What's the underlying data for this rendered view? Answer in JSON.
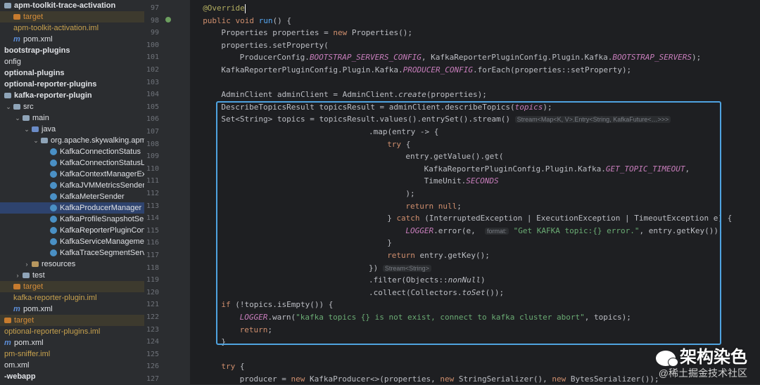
{
  "tree": [
    {
      "label": "apm-toolkit-trace-activation",
      "indent": 0,
      "style": "bold",
      "icon": "folder"
    },
    {
      "label": "target",
      "indent": 1,
      "style": "orange",
      "icon": "folder-target",
      "row": "hlrow"
    },
    {
      "label": "apm-toolkit-activation.iml",
      "indent": 1,
      "style": "yellowish",
      "icon": "none"
    },
    {
      "label": "pom.xml",
      "indent": 1,
      "style": "",
      "icon": "maven"
    },
    {
      "label": "bootstrap-plugins",
      "indent": 0,
      "style": "bold",
      "icon": "none"
    },
    {
      "label": "onfig",
      "indent": 0,
      "style": "",
      "icon": "none"
    },
    {
      "label": "optional-plugins",
      "indent": 0,
      "style": "bold",
      "icon": "none"
    },
    {
      "label": "optional-reporter-plugins",
      "indent": 0,
      "style": "bold",
      "icon": "none"
    },
    {
      "label": "kafka-reporter-plugin",
      "indent": 0,
      "style": "bold",
      "icon": "folder"
    },
    {
      "label": "src",
      "indent": 1,
      "style": "",
      "icon": "folder",
      "arrow": "v"
    },
    {
      "label": "main",
      "indent": 2,
      "style": "",
      "icon": "folder",
      "arrow": "v"
    },
    {
      "label": "java",
      "indent": 3,
      "style": "",
      "icon": "folder-src",
      "arrow": "v"
    },
    {
      "label": "org.apache.skywalking.apm",
      "indent": 4,
      "style": "",
      "icon": "folder",
      "arrow": "v"
    },
    {
      "label": "KafkaConnectionStatus",
      "indent": 5,
      "style": "",
      "icon": "class"
    },
    {
      "label": "KafkaConnectionStatusL",
      "indent": 5,
      "style": "",
      "icon": "class"
    },
    {
      "label": "KafkaContextManagerEx",
      "indent": 5,
      "style": "",
      "icon": "class"
    },
    {
      "label": "KafkaJVMMetricsSender",
      "indent": 5,
      "style": "",
      "icon": "class"
    },
    {
      "label": "KafkaMeterSender",
      "indent": 5,
      "style": "",
      "icon": "class"
    },
    {
      "label": "KafkaProducerManager",
      "indent": 5,
      "style": "",
      "icon": "class",
      "row": "sel"
    },
    {
      "label": "KafkaProfileSnapshotSer",
      "indent": 5,
      "style": "",
      "icon": "class"
    },
    {
      "label": "KafkaReporterPluginCon",
      "indent": 5,
      "style": "",
      "icon": "class"
    },
    {
      "label": "KafkaServiceManagemer",
      "indent": 5,
      "style": "",
      "icon": "class"
    },
    {
      "label": "KafkaTraceSegmentServiceClient",
      "indent": 5,
      "style": "",
      "icon": "class"
    },
    {
      "label": "resources",
      "indent": 3,
      "style": "",
      "icon": "folder-res",
      "arrow": ">"
    },
    {
      "label": "test",
      "indent": 2,
      "style": "",
      "icon": "folder",
      "arrow": ">"
    },
    {
      "label": "target",
      "indent": 1,
      "style": "orange",
      "icon": "folder-target",
      "row": "hlrow"
    },
    {
      "label": "kafka-reporter-plugin.iml",
      "indent": 1,
      "style": "yellowish",
      "icon": "none"
    },
    {
      "label": "pom.xml",
      "indent": 1,
      "style": "",
      "icon": "maven"
    },
    {
      "label": "target",
      "indent": 0,
      "style": "orange",
      "icon": "folder-target",
      "row": "hlrow"
    },
    {
      "label": "optional-reporter-plugins.iml",
      "indent": 0,
      "style": "yellowish",
      "icon": "none"
    },
    {
      "label": "pom.xml",
      "indent": 0,
      "style": "",
      "icon": "maven"
    },
    {
      "label": "pm-sniffer.iml",
      "indent": 0,
      "style": "yellowish",
      "icon": "none"
    },
    {
      "label": "om.xml",
      "indent": 0,
      "style": "",
      "icon": "none"
    },
    {
      "label": "-webapp",
      "indent": 0,
      "style": "bold",
      "icon": "none"
    }
  ],
  "line_numbers": [
    "97",
    "98",
    "99",
    "100",
    "101",
    "102",
    "103",
    "104",
    "105",
    "106",
    "107",
    "108",
    "109",
    "110",
    "111",
    "112",
    "113",
    "114",
    "115",
    "116",
    "117",
    "118",
    "119",
    "120",
    "121",
    "122",
    "123",
    "124",
    "125",
    "126",
    "127"
  ],
  "code_lines": [
    {
      "indent": 1,
      "tokens": [
        [
          "an",
          "@Override"
        ],
        [
          "cursor",
          ""
        ]
      ]
    },
    {
      "indent": 1,
      "tokens": [
        [
          "kw",
          "public "
        ],
        [
          "kw",
          "void "
        ],
        [
          "fn",
          "run"
        ],
        [
          "",
          "() {"
        ]
      ]
    },
    {
      "indent": 2,
      "tokens": [
        [
          "",
          "Properties properties = "
        ],
        [
          "kw",
          "new "
        ],
        [
          "",
          "Properties();"
        ]
      ]
    },
    {
      "indent": 2,
      "tokens": [
        [
          "",
          "properties.setProperty("
        ]
      ]
    },
    {
      "indent": 3,
      "tokens": [
        [
          "",
          "ProducerConfig."
        ],
        [
          "it",
          "BOOTSTRAP_SERVERS_CONFIG"
        ],
        [
          "",
          ", KafkaReporterPluginConfig.Plugin.Kafka."
        ],
        [
          "it",
          "BOOTSTRAP_SERVERS"
        ],
        [
          "",
          ");"
        ]
      ]
    },
    {
      "indent": 2,
      "tokens": [
        [
          "",
          "KafkaReporterPluginConfig.Plugin.Kafka."
        ],
        [
          "it",
          "PRODUCER_CONFIG"
        ],
        [
          "",
          ".forEach(properties::setProperty);"
        ]
      ]
    },
    {
      "indent": 0,
      "tokens": []
    },
    {
      "indent": 2,
      "tokens": [
        [
          "",
          "AdminClient adminClient = AdminClient."
        ],
        [
          "itw",
          "create"
        ],
        [
          "",
          "(properties);"
        ]
      ]
    },
    {
      "indent": 2,
      "tokens": [
        [
          "",
          "DescribeTopicsResult topicsResult = adminClient.describeTopics("
        ],
        [
          "it",
          "topics"
        ],
        [
          "",
          ");"
        ]
      ]
    },
    {
      "indent": 2,
      "tokens": [
        [
          "",
          "Set<String> topics = topicsResult.values().entrySet().stream() "
        ],
        [
          "hint",
          "Stream<Map<K, V>.Entry<String, KafkaFuture<…>>>"
        ]
      ]
    },
    {
      "indent": 10,
      "tokens": [
        [
          "",
          ".map(entry -> {"
        ]
      ]
    },
    {
      "indent": 11,
      "tokens": [
        [
          "kw",
          "try "
        ],
        [
          "",
          "{"
        ]
      ]
    },
    {
      "indent": 12,
      "tokens": [
        [
          "",
          "entry.getValue().get("
        ]
      ]
    },
    {
      "indent": 13,
      "tokens": [
        [
          "",
          "KafkaReporterPluginConfig.Plugin.Kafka."
        ],
        [
          "it",
          "GET_TOPIC_TIMEOUT"
        ],
        [
          "",
          ","
        ]
      ]
    },
    {
      "indent": 13,
      "tokens": [
        [
          "",
          "TimeUnit."
        ],
        [
          "it",
          "SECONDS"
        ]
      ]
    },
    {
      "indent": 12,
      "tokens": [
        [
          "",
          ");"
        ]
      ]
    },
    {
      "indent": 12,
      "tokens": [
        [
          "kw",
          "return null"
        ],
        [
          "",
          ";"
        ]
      ]
    },
    {
      "indent": 11,
      "tokens": [
        [
          "",
          "} "
        ],
        [
          "kw",
          "catch "
        ],
        [
          "",
          "(InterruptedException | ExecutionException | TimeoutException e) {"
        ]
      ]
    },
    {
      "indent": 12,
      "tokens": [
        [
          "it",
          "LOGGER"
        ],
        [
          "",
          ".error(e,  "
        ],
        [
          "hint",
          "format:"
        ],
        [
          "st",
          " \"Get KAFKA topic:{} error.\""
        ],
        [
          "",
          ", entry.getKey());"
        ]
      ]
    },
    {
      "indent": 11,
      "tokens": [
        [
          "",
          "}"
        ]
      ]
    },
    {
      "indent": 11,
      "tokens": [
        [
          "kw",
          "return "
        ],
        [
          "",
          "entry.getKey();"
        ]
      ]
    },
    {
      "indent": 10,
      "tokens": [
        [
          "",
          "}) "
        ],
        [
          "hint",
          "Stream<String>"
        ]
      ]
    },
    {
      "indent": 10,
      "tokens": [
        [
          "",
          ".filter(Objects::"
        ],
        [
          "itw",
          "nonNull"
        ],
        [
          "",
          ")"
        ]
      ]
    },
    {
      "indent": 10,
      "tokens": [
        [
          "",
          ".collect(Collectors."
        ],
        [
          "itw",
          "toSet"
        ],
        [
          "",
          "());"
        ]
      ]
    },
    {
      "indent": 2,
      "tokens": [
        [
          "kw",
          "if "
        ],
        [
          "",
          "(!topics.isEmpty()) {"
        ]
      ]
    },
    {
      "indent": 3,
      "tokens": [
        [
          "it",
          "LOGGER"
        ],
        [
          "",
          ".warn("
        ],
        [
          "st",
          "\"kafka topics {} is not exist, connect to kafka cluster abort\""
        ],
        [
          "",
          ", topics);"
        ]
      ]
    },
    {
      "indent": 3,
      "tokens": [
        [
          "kw",
          "return"
        ],
        [
          "",
          ";"
        ]
      ]
    },
    {
      "indent": 2,
      "tokens": [
        [
          "",
          "}"
        ]
      ]
    },
    {
      "indent": 0,
      "tokens": []
    },
    {
      "indent": 2,
      "tokens": [
        [
          "kw",
          "try "
        ],
        [
          "",
          "{"
        ]
      ]
    },
    {
      "indent": 3,
      "tokens": [
        [
          "",
          "producer = "
        ],
        [
          "kw",
          "new "
        ],
        [
          "",
          "KafkaProducer<>(properties, "
        ],
        [
          "kw",
          "new "
        ],
        [
          "",
          "StringSerializer(), "
        ],
        [
          "kw",
          "new "
        ],
        [
          "",
          "BytesSerializer());"
        ]
      ]
    }
  ],
  "watermark": {
    "title": "架构染色",
    "subtitle": "@稀土掘金技术社区"
  }
}
